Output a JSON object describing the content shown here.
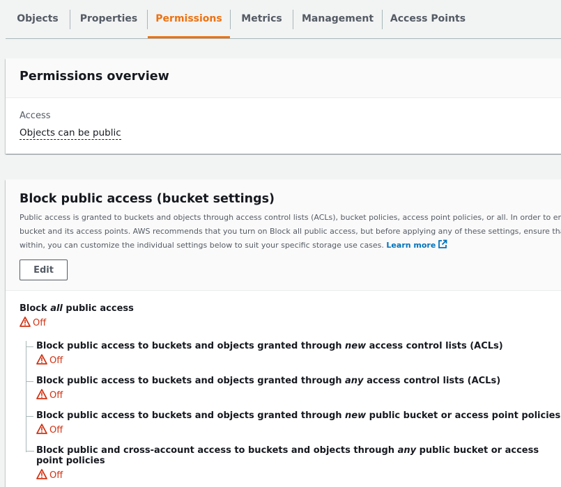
{
  "tabs": [
    {
      "label": "Objects"
    },
    {
      "label": "Properties"
    },
    {
      "label": "Permissions",
      "active": true
    },
    {
      "label": "Metrics"
    },
    {
      "label": "Management"
    },
    {
      "label": "Access Points"
    }
  ],
  "overview": {
    "title": "Permissions overview",
    "access_label": "Access",
    "access_value": "Objects can be public"
  },
  "block_public_access": {
    "title": "Block public access (bucket settings)",
    "description_lines": [
      "Public access is granted to buckets and objects through access control lists (ACLs), bucket policies, access point policies, or all. In order to ensure",
      "bucket and its access points. AWS recommends that you turn on Block all public access, but before applying any of these settings, ensure that y",
      "within, you can customize the individual settings below to suit your specific storage use cases."
    ],
    "learn_more": "Learn more",
    "edit_label": "Edit",
    "main_setting": {
      "label_pre": "Block ",
      "label_em": "all",
      "label_post": " public access",
      "status": "Off"
    },
    "sub_settings": [
      {
        "pre": "Block public access to buckets and objects granted through ",
        "em": "new",
        "post": " access control lists (ACLs)",
        "status": "Off"
      },
      {
        "pre": "Block public access to buckets and objects granted through ",
        "em": "any",
        "post": " access control lists (ACLs)",
        "status": "Off"
      },
      {
        "pre": "Block public access to buckets and objects granted through ",
        "em": "new",
        "post": " public bucket or access point policies",
        "status": "Off"
      },
      {
        "pre": "Block public and cross-account access to buckets and objects through ",
        "em": "any",
        "post": " public bucket or access point policies",
        "status": "Off"
      }
    ]
  },
  "colors": {
    "accent": "#ec7211",
    "link": "#0073bb",
    "warning": "#d13212"
  },
  "icons": {
    "warning": "warning-triangle-icon",
    "external": "external-link-icon"
  }
}
